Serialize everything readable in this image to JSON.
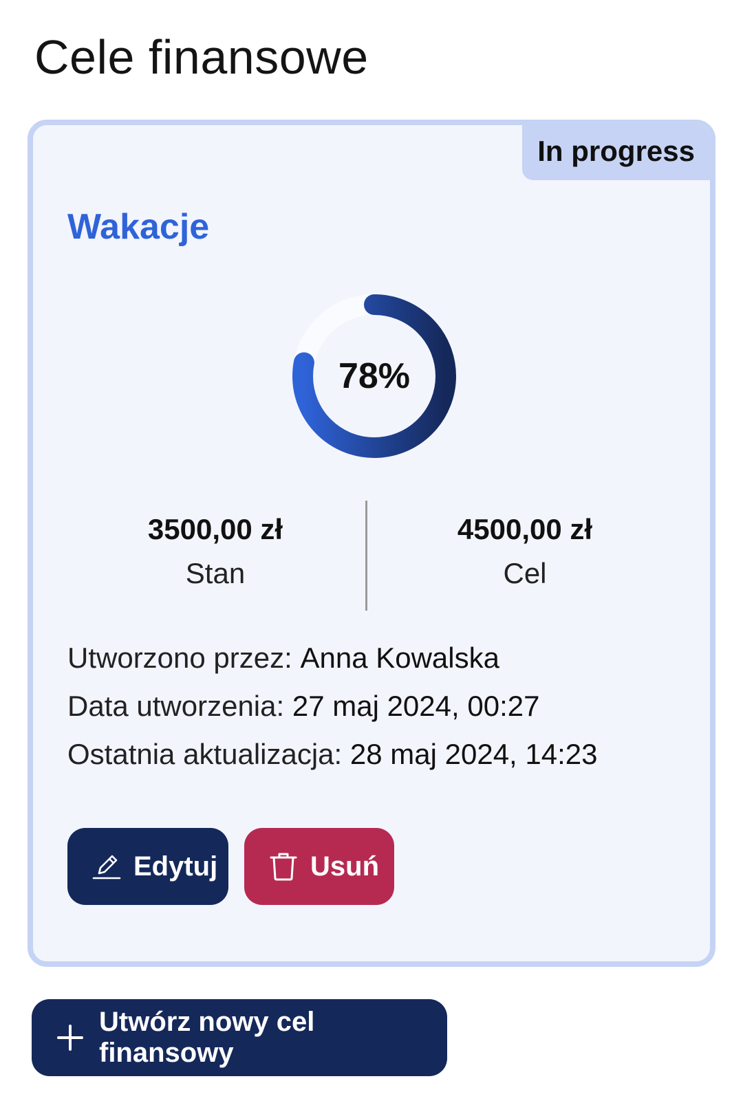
{
  "header": {
    "title": "Cele finansowe"
  },
  "goal": {
    "status": "In progress",
    "name": "Wakacje",
    "progress_percent": 78,
    "progress_label": "78%",
    "current_amount": "3500,00 zł",
    "current_label": "Stan",
    "target_amount": "4500,00 zł",
    "target_label": "Cel",
    "created_by_label": "Utworzono przez:",
    "created_by": "Anna Kowalska",
    "created_at_label": "Data utworzenia:",
    "created_at": "27 maj 2024, 00:27",
    "updated_at_label": "Ostatnia aktualizacja:",
    "updated_at": "28 maj 2024, 14:23",
    "edit_label": "Edytuj",
    "delete_label": "Usuń"
  },
  "actions": {
    "create_label": "Utwórz nowy cel finansowy"
  },
  "colors": {
    "accent": "#2f63d8",
    "primary_button": "#15285a",
    "danger_button": "#b62a51",
    "card_border": "#c5d3f4",
    "card_background": "#f3f5fd",
    "ring_start": "#2f63d8",
    "ring_end": "#15285a"
  },
  "icons": {
    "edit": "pencil-icon",
    "delete": "trash-icon",
    "create": "plus-icon"
  }
}
